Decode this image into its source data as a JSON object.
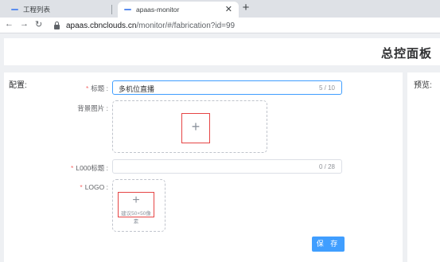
{
  "browser": {
    "tabs": [
      {
        "label": "工程列表",
        "active": false
      },
      {
        "label": "apaas-monitor",
        "active": true
      }
    ],
    "close_symbol": "✕",
    "new_tab_symbol": "+",
    "back_symbol": "←",
    "forward_symbol": "→",
    "reload_symbol": "↻",
    "url_host": "apaas.cbnclouds.cn",
    "url_path": "/monitor/#/fabrication?id=99"
  },
  "header": {
    "title": "总控面板"
  },
  "config": {
    "section_label": "配置:"
  },
  "preview": {
    "section_label": "预览:"
  },
  "form": {
    "title_field": {
      "label": "标题 :",
      "required_mark": "*",
      "value": "多机位直播",
      "counter": "5 / 10"
    },
    "bg_image": {
      "label": "背景图片 :",
      "plus": "+"
    },
    "loo_title": {
      "label": "L000标题 :",
      "required_mark": "*",
      "value": "",
      "counter": "0 / 28"
    },
    "logo": {
      "label": "LOGO :",
      "required_mark": "*",
      "plus": "+",
      "hint": "建议50×50像素"
    },
    "save_label": "保 存"
  },
  "colors": {
    "accent": "#409eff",
    "required": "#f56c6c",
    "upload_highlight": "#e64545"
  }
}
